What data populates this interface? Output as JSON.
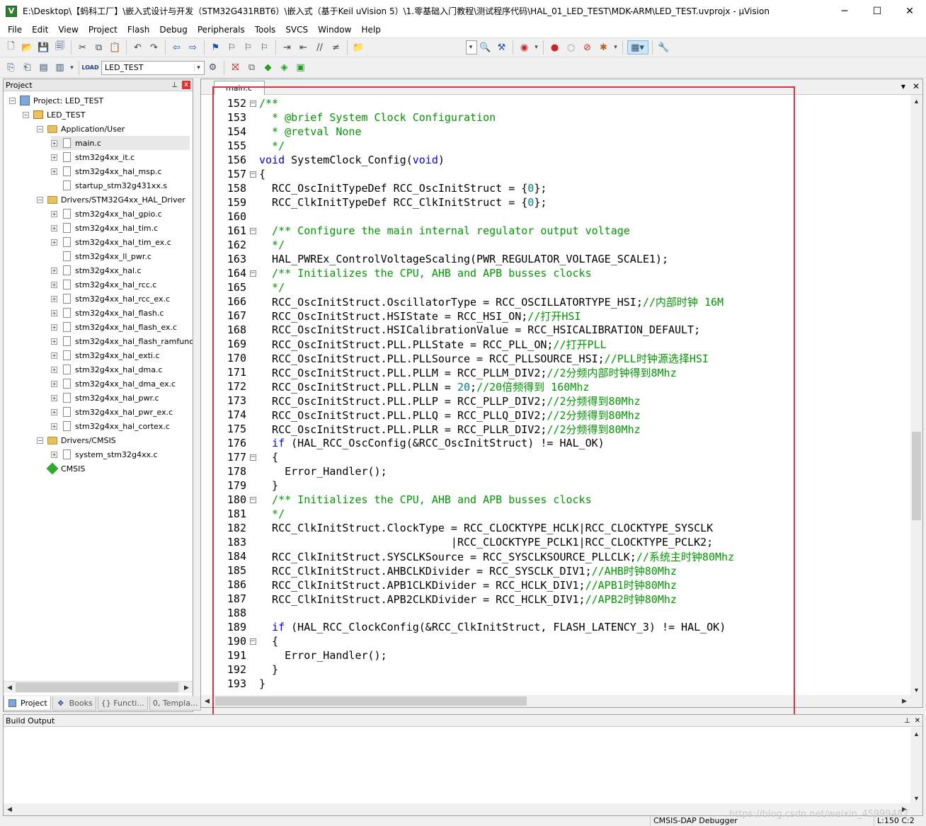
{
  "window": {
    "title": "E:\\Desktop\\【蚂科工厂】\\嵌入式设计与开发（STM32G431RBT6）\\嵌入式（基于Keil uVision 5）\\1.零基础入门教程\\测试程序代码\\HAL_01_LED_TEST\\MDK-ARM\\LED_TEST.uvprojx - µVision",
    "icon_label": "V",
    "minimize": "─",
    "maximize": "☐",
    "close": "✕"
  },
  "menu": [
    "File",
    "Edit",
    "View",
    "Project",
    "Flash",
    "Debug",
    "Peripherals",
    "Tools",
    "SVCS",
    "Window",
    "Help"
  ],
  "toolbar2": {
    "target_combo": "LED_TEST"
  },
  "project_panel": {
    "title": "Project",
    "pin": "⊥",
    "close": "x",
    "tree": [
      {
        "label": "Project: LED_TEST",
        "level": 0,
        "icon": "project-icon",
        "expander": "minus",
        "selected": false
      },
      {
        "label": "LED_TEST",
        "level": 1,
        "icon": "target-icon",
        "expander": "minus",
        "selected": false
      },
      {
        "label": "Application/User",
        "level": 2,
        "icon": "folder-icon",
        "expander": "minus",
        "selected": false
      },
      {
        "label": "main.c",
        "level": 3,
        "icon": "file-icon",
        "expander": "plus",
        "selected": true
      },
      {
        "label": "stm32g4xx_it.c",
        "level": 3,
        "icon": "file-icon",
        "expander": "plus",
        "selected": false
      },
      {
        "label": "stm32g4xx_hal_msp.c",
        "level": 3,
        "icon": "file-icon",
        "expander": "plus",
        "selected": false
      },
      {
        "label": "startup_stm32g431xx.s",
        "level": 3,
        "icon": "file-icon",
        "expander": "none",
        "selected": false
      },
      {
        "label": "Drivers/STM32G4xx_HAL_Driver",
        "level": 2,
        "icon": "folder-icon",
        "expander": "minus",
        "selected": false
      },
      {
        "label": "stm32g4xx_hal_gpio.c",
        "level": 3,
        "icon": "file-icon",
        "expander": "plus",
        "selected": false
      },
      {
        "label": "stm32g4xx_hal_tim.c",
        "level": 3,
        "icon": "file-icon",
        "expander": "plus",
        "selected": false
      },
      {
        "label": "stm32g4xx_hal_tim_ex.c",
        "level": 3,
        "icon": "file-icon",
        "expander": "plus",
        "selected": false
      },
      {
        "label": "stm32g4xx_ll_pwr.c",
        "level": 3,
        "icon": "file-icon",
        "expander": "none",
        "selected": false
      },
      {
        "label": "stm32g4xx_hal.c",
        "level": 3,
        "icon": "file-icon",
        "expander": "plus",
        "selected": false
      },
      {
        "label": "stm32g4xx_hal_rcc.c",
        "level": 3,
        "icon": "file-icon",
        "expander": "plus",
        "selected": false
      },
      {
        "label": "stm32g4xx_hal_rcc_ex.c",
        "level": 3,
        "icon": "file-icon",
        "expander": "plus",
        "selected": false
      },
      {
        "label": "stm32g4xx_hal_flash.c",
        "level": 3,
        "icon": "file-icon",
        "expander": "plus",
        "selected": false
      },
      {
        "label": "stm32g4xx_hal_flash_ex.c",
        "level": 3,
        "icon": "file-icon",
        "expander": "plus",
        "selected": false
      },
      {
        "label": "stm32g4xx_hal_flash_ramfunc.",
        "level": 3,
        "icon": "file-icon",
        "expander": "plus",
        "selected": false
      },
      {
        "label": "stm32g4xx_hal_exti.c",
        "level": 3,
        "icon": "file-icon",
        "expander": "plus",
        "selected": false
      },
      {
        "label": "stm32g4xx_hal_dma.c",
        "level": 3,
        "icon": "file-icon",
        "expander": "plus",
        "selected": false
      },
      {
        "label": "stm32g4xx_hal_dma_ex.c",
        "level": 3,
        "icon": "file-icon",
        "expander": "plus",
        "selected": false
      },
      {
        "label": "stm32g4xx_hal_pwr.c",
        "level": 3,
        "icon": "file-icon",
        "expander": "plus",
        "selected": false
      },
      {
        "label": "stm32g4xx_hal_pwr_ex.c",
        "level": 3,
        "icon": "file-icon",
        "expander": "plus",
        "selected": false
      },
      {
        "label": "stm32g4xx_hal_cortex.c",
        "level": 3,
        "icon": "file-icon",
        "expander": "plus",
        "selected": false
      },
      {
        "label": "Drivers/CMSIS",
        "level": 2,
        "icon": "folder-icon",
        "expander": "minus",
        "selected": false
      },
      {
        "label": "system_stm32g4xx.c",
        "level": 3,
        "icon": "file-icon",
        "expander": "plus",
        "selected": false
      },
      {
        "label": "CMSIS",
        "level": 2,
        "icon": "cmsis-icon",
        "expander": "none",
        "selected": false
      }
    ],
    "tabs": [
      {
        "label": "Project",
        "active": true
      },
      {
        "label": "Books",
        "active": false
      },
      {
        "label": "{} Functi...",
        "active": false
      },
      {
        "label": "0, Templa...",
        "active": false
      }
    ]
  },
  "editor": {
    "tab_label": "main.c",
    "lines": [
      {
        "num": "152",
        "fold": "minus",
        "parts": [
          {
            "t": "/**",
            "c": "com"
          }
        ]
      },
      {
        "num": "153",
        "fold": "",
        "parts": [
          {
            "t": "  * @brief System Clock Configuration",
            "c": "com"
          }
        ]
      },
      {
        "num": "154",
        "fold": "",
        "parts": [
          {
            "t": "  * @retval None",
            "c": "com"
          }
        ]
      },
      {
        "num": "155",
        "fold": "",
        "parts": [
          {
            "t": "  */",
            "c": "com"
          }
        ]
      },
      {
        "num": "156",
        "fold": "",
        "parts": [
          {
            "t": "void",
            "c": "kw"
          },
          {
            "t": " SystemClock_Config(",
            "c": ""
          },
          {
            "t": "void",
            "c": "kw"
          },
          {
            "t": ")",
            "c": ""
          }
        ]
      },
      {
        "num": "157",
        "fold": "minus",
        "parts": [
          {
            "t": "{",
            "c": ""
          }
        ]
      },
      {
        "num": "158",
        "fold": "",
        "parts": [
          {
            "t": "  RCC_OscInitTypeDef RCC_OscInitStruct = {",
            "c": ""
          },
          {
            "t": "0",
            "c": "num"
          },
          {
            "t": "};",
            "c": ""
          }
        ]
      },
      {
        "num": "159",
        "fold": "",
        "parts": [
          {
            "t": "  RCC_ClkInitTypeDef RCC_ClkInitStruct = {",
            "c": ""
          },
          {
            "t": "0",
            "c": "num"
          },
          {
            "t": "};",
            "c": ""
          }
        ]
      },
      {
        "num": "160",
        "fold": "",
        "parts": []
      },
      {
        "num": "161",
        "fold": "minus",
        "parts": [
          {
            "t": "  /** Configure the main internal regulator output voltage",
            "c": "com"
          }
        ]
      },
      {
        "num": "162",
        "fold": "",
        "parts": [
          {
            "t": "  */",
            "c": "com"
          }
        ]
      },
      {
        "num": "163",
        "fold": "",
        "parts": [
          {
            "t": "  HAL_PWREx_ControlVoltageScaling(PWR_REGULATOR_VOLTAGE_SCALE1);",
            "c": ""
          }
        ]
      },
      {
        "num": "164",
        "fold": "minus",
        "parts": [
          {
            "t": "  /** Initializes the CPU, AHB and APB busses clocks",
            "c": "com"
          }
        ]
      },
      {
        "num": "165",
        "fold": "",
        "parts": [
          {
            "t": "  */",
            "c": "com"
          }
        ]
      },
      {
        "num": "166",
        "fold": "",
        "parts": [
          {
            "t": "  RCC_OscInitStruct.OscillatorType = RCC_OSCILLATORTYPE_HSI;",
            "c": ""
          },
          {
            "t": "//内部时钟 16M",
            "c": "com"
          }
        ]
      },
      {
        "num": "167",
        "fold": "",
        "parts": [
          {
            "t": "  RCC_OscInitStruct.HSIState = RCC_HSI_ON;",
            "c": ""
          },
          {
            "t": "//打开HSI",
            "c": "com"
          }
        ]
      },
      {
        "num": "168",
        "fold": "",
        "parts": [
          {
            "t": "  RCC_OscInitStruct.HSICalibrationValue = RCC_HSICALIBRATION_DEFAULT;",
            "c": ""
          }
        ]
      },
      {
        "num": "169",
        "fold": "",
        "parts": [
          {
            "t": "  RCC_OscInitStruct.PLL.PLLState = RCC_PLL_ON;",
            "c": ""
          },
          {
            "t": "//打开PLL",
            "c": "com"
          }
        ]
      },
      {
        "num": "170",
        "fold": "",
        "parts": [
          {
            "t": "  RCC_OscInitStruct.PLL.PLLSource = RCC_PLLSOURCE_HSI;",
            "c": ""
          },
          {
            "t": "//PLL时钟源选择HSI",
            "c": "com"
          }
        ]
      },
      {
        "num": "171",
        "fold": "",
        "parts": [
          {
            "t": "  RCC_OscInitStruct.PLL.PLLM = RCC_PLLM_DIV2;",
            "c": ""
          },
          {
            "t": "//2分频内部时钟得到8Mhz",
            "c": "com"
          }
        ]
      },
      {
        "num": "172",
        "fold": "",
        "parts": [
          {
            "t": "  RCC_OscInitStruct.PLL.PLLN = ",
            "c": ""
          },
          {
            "t": "20",
            "c": "num"
          },
          {
            "t": ";",
            "c": ""
          },
          {
            "t": "//20倍频得到 160Mhz",
            "c": "com"
          }
        ]
      },
      {
        "num": "173",
        "fold": "",
        "parts": [
          {
            "t": "  RCC_OscInitStruct.PLL.PLLP = RCC_PLLP_DIV2;",
            "c": ""
          },
          {
            "t": "//2分频得到80Mhz",
            "c": "com"
          }
        ]
      },
      {
        "num": "174",
        "fold": "",
        "parts": [
          {
            "t": "  RCC_OscInitStruct.PLL.PLLQ = RCC_PLLQ_DIV2;",
            "c": ""
          },
          {
            "t": "//2分频得到80Mhz",
            "c": "com"
          }
        ]
      },
      {
        "num": "175",
        "fold": "",
        "parts": [
          {
            "t": "  RCC_OscInitStruct.PLL.PLLR = RCC_PLLR_DIV2;",
            "c": ""
          },
          {
            "t": "//2分频得到80Mhz",
            "c": "com"
          }
        ]
      },
      {
        "num": "176",
        "fold": "",
        "parts": [
          {
            "t": "  ",
            "c": ""
          },
          {
            "t": "if",
            "c": "kw"
          },
          {
            "t": " (HAL_RCC_OscConfig(&RCC_OscInitStruct) != HAL_OK)",
            "c": ""
          }
        ]
      },
      {
        "num": "177",
        "fold": "minus",
        "parts": [
          {
            "t": "  {",
            "c": ""
          }
        ]
      },
      {
        "num": "178",
        "fold": "",
        "parts": [
          {
            "t": "    Error_Handler();",
            "c": ""
          }
        ]
      },
      {
        "num": "179",
        "fold": "",
        "parts": [
          {
            "t": "  }",
            "c": ""
          }
        ]
      },
      {
        "num": "180",
        "fold": "minus",
        "parts": [
          {
            "t": "  /** Initializes the CPU, AHB and APB busses clocks",
            "c": "com"
          }
        ]
      },
      {
        "num": "181",
        "fold": "",
        "parts": [
          {
            "t": "  */",
            "c": "com"
          }
        ]
      },
      {
        "num": "182",
        "fold": "",
        "parts": [
          {
            "t": "  RCC_ClkInitStruct.ClockType = RCC_CLOCKTYPE_HCLK|RCC_CLOCKTYPE_SYSCLK",
            "c": ""
          }
        ]
      },
      {
        "num": "183",
        "fold": "",
        "parts": [
          {
            "t": "                              |RCC_CLOCKTYPE_PCLK1|RCC_CLOCKTYPE_PCLK2;",
            "c": ""
          }
        ]
      },
      {
        "num": "184",
        "fold": "",
        "parts": [
          {
            "t": "  RCC_ClkInitStruct.SYSCLKSource = RCC_SYSCLKSOURCE_PLLCLK;",
            "c": ""
          },
          {
            "t": "//系统主时钟80Mhz",
            "c": "com"
          }
        ]
      },
      {
        "num": "185",
        "fold": "",
        "parts": [
          {
            "t": "  RCC_ClkInitStruct.AHBCLKDivider = RCC_SYSCLK_DIV1;",
            "c": ""
          },
          {
            "t": "//AHB时钟80Mhz",
            "c": "com"
          }
        ]
      },
      {
        "num": "186",
        "fold": "",
        "parts": [
          {
            "t": "  RCC_ClkInitStruct.APB1CLKDivider = RCC_HCLK_DIV1;",
            "c": ""
          },
          {
            "t": "//APB1时钟80Mhz",
            "c": "com"
          }
        ]
      },
      {
        "num": "187",
        "fold": "",
        "parts": [
          {
            "t": "  RCC_ClkInitStruct.APB2CLKDivider = RCC_HCLK_DIV1;",
            "c": ""
          },
          {
            "t": "//APB2时钟80Mhz",
            "c": "com"
          }
        ]
      },
      {
        "num": "188",
        "fold": "",
        "parts": []
      },
      {
        "num": "189",
        "fold": "",
        "parts": [
          {
            "t": "  ",
            "c": ""
          },
          {
            "t": "if",
            "c": "kw"
          },
          {
            "t": " (HAL_RCC_ClockConfig(&RCC_ClkInitStruct, FLASH_LATENCY_3) != HAL_OK)",
            "c": ""
          }
        ]
      },
      {
        "num": "190",
        "fold": "minus",
        "parts": [
          {
            "t": "  {",
            "c": ""
          }
        ]
      },
      {
        "num": "191",
        "fold": "",
        "parts": [
          {
            "t": "    Error_Handler();",
            "c": ""
          }
        ]
      },
      {
        "num": "192",
        "fold": "",
        "parts": [
          {
            "t": "  }",
            "c": ""
          }
        ]
      },
      {
        "num": "193",
        "fold": "",
        "parts": [
          {
            "t": "}",
            "c": ""
          }
        ]
      }
    ]
  },
  "build_output": {
    "title": "Build Output"
  },
  "statusbar": {
    "debugger": "CMSIS-DAP Debugger",
    "position": "L:150 C:2"
  },
  "watermark": "https://blog.csdn.net/weixin_45999487",
  "colors": {
    "comment": "#009900",
    "keyword": "#0000ff",
    "number": "#008080",
    "highlight_box": "#e03040"
  }
}
